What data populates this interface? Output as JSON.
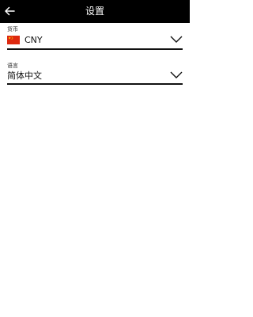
{
  "header": {
    "title": "设置",
    "back_icon": "arrow-left-icon"
  },
  "currency": {
    "label": "货币",
    "value": "CNY",
    "flag_icon": "china-flag-icon"
  },
  "language": {
    "label": "语言",
    "value": "简体中文"
  },
  "colors": {
    "header_bg": "#000000",
    "header_text": "#ffffff",
    "underline": "#111111"
  }
}
